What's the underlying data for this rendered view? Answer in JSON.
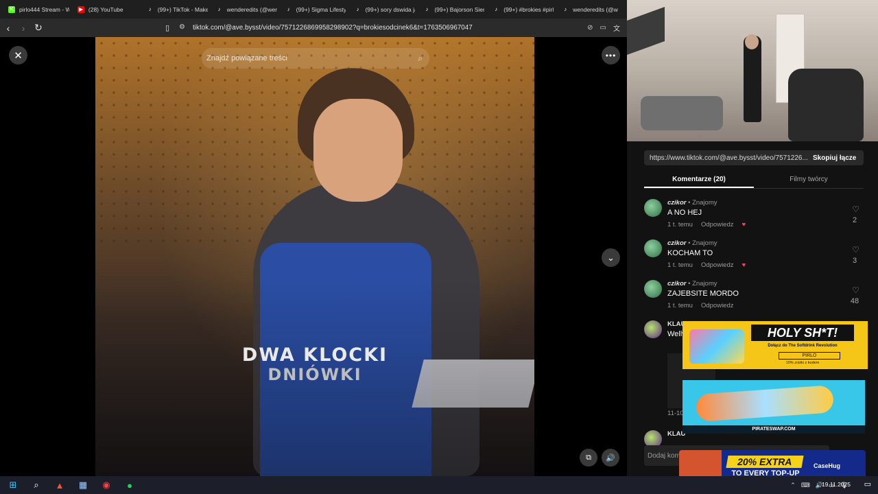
{
  "browser": {
    "tabs": [
      {
        "title": "pirlo444 Stream - W",
        "favicon": "kick-icon",
        "color": "#53fc18",
        "glyph": "K"
      },
      {
        "title": "(28) YouTube",
        "favicon": "youtube-icon",
        "color": "#ff0000",
        "glyph": "▶"
      },
      {
        "title": "(99+) TikTok - Make",
        "favicon": "tiktok-icon",
        "color": "#1f1f1f",
        "glyph": "♪"
      },
      {
        "title": "wenderedits (@wen",
        "favicon": "tiktok-icon",
        "color": "#1f1f1f",
        "glyph": "♪"
      },
      {
        "title": "(99+) Sigma Lifesty",
        "favicon": "tiktok-icon",
        "color": "#1f1f1f",
        "glyph": "♪"
      },
      {
        "title": "(99+) sory dswida ja",
        "favicon": "tiktok-icon",
        "color": "#1f1f1f",
        "glyph": "♪"
      },
      {
        "title": "(99+) Bajorson Siem",
        "favicon": "tiktok-icon",
        "color": "#1f1f1f",
        "glyph": "♪"
      },
      {
        "title": "(99+) #brokies #pirl",
        "favicon": "tiktok-icon",
        "color": "#1f1f1f",
        "glyph": "♪"
      },
      {
        "title": "wenderedits (@w",
        "favicon": "tiktok-icon",
        "color": "#1f1f1f",
        "glyph": "♪"
      }
    ],
    "url": "tiktok.com/@ave.bysst/video/7571226869958298902?q=brokiesodcinek6&t=1763506967047"
  },
  "video": {
    "search_placeholder": "Znajdź powiązane treści",
    "headline_line1": "DWA KLOCKI",
    "headline_line2": "DNIÓWKI"
  },
  "panel": {
    "share_url": "https://www.tiktok.com/@ave.bysst/video/7571226...",
    "copy_label": "Skopiuj łącze",
    "tab_comments": "Komentarze (20)",
    "tab_creator": "Filmy twórcy",
    "comments": [
      {
        "user": "czikor",
        "tag": " • Znajomy",
        "text": "A NO HEJ",
        "time": "1 t. temu",
        "reply": "Odpowiedz",
        "likes": "2"
      },
      {
        "user": "czikor",
        "tag": " • Znajomy",
        "text": "KOCHAM TO",
        "time": "1 t. temu",
        "reply": "Odpowiedz",
        "likes": "3"
      },
      {
        "user": "czikor",
        "tag": " • Znajomy",
        "text": "ZAJEBSITE MORDO",
        "time": "1 t. temu",
        "reply": "Odpowiedz",
        "likes": "48"
      }
    ],
    "partial_user": "KLAUDIA",
    "partial_text": "Wellwell",
    "partial_date": "11-10",
    "partial_user2": "KLAU",
    "add_comment_placeholder": "Dodaj kom"
  },
  "ads": {
    "ad1_title": "HOLY SH*T!",
    "ad1_sub": "Dołącz do The Softdrink Revolution",
    "ad1_code": "PIRLO",
    "ad1_foot": "10% zniżki z kodem",
    "ad2_foot": "PIRATESWAP.COM",
    "ad3_badge": "20% EXTRA",
    "ad3_sub": "TO EVERY TOP-UP",
    "ad3_brand": "CaseHug"
  },
  "taskbar": {
    "date": "19.11.2025"
  }
}
